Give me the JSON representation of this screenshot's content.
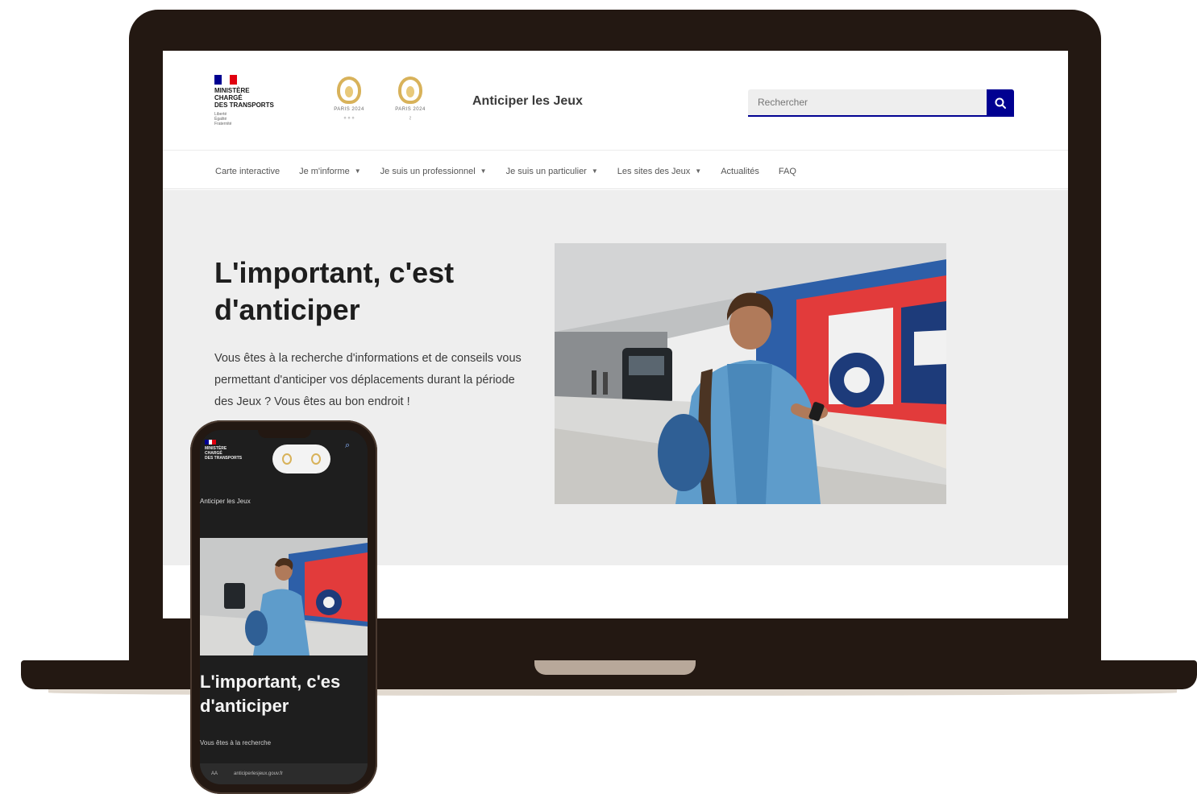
{
  "header": {
    "ministry_name": "Ministère\nchargé\ndes transports",
    "ministry_motto": "Liberté\nÉgalité\nFraternité",
    "games_logos": [
      {
        "caption": "PARIS 2024",
        "symbol": "∘∘∘"
      },
      {
        "caption": "PARIS 2024",
        "symbol": "≀"
      }
    ],
    "site_title": "Anticiper les Jeux",
    "search_placeholder": "Rechercher"
  },
  "nav": {
    "items": [
      {
        "label": "Carte interactive",
        "has_menu": false
      },
      {
        "label": "Je m'informe",
        "has_menu": true
      },
      {
        "label": "Je suis un professionnel",
        "has_menu": true
      },
      {
        "label": "Je suis un particulier",
        "has_menu": true
      },
      {
        "label": "Les sites des Jeux",
        "has_menu": true
      },
      {
        "label": "Actualités",
        "has_menu": false
      },
      {
        "label": "FAQ",
        "has_menu": false
      }
    ]
  },
  "hero": {
    "title": "L'important, c'est d'anticiper",
    "text": "Vous êtes à la recherche d'informations et de conseils vous permettant d'anticiper vos déplacements durant la période des Jeux ? Vous êtes au bon endroit !"
  },
  "phone": {
    "site_title": "Anticiper les Jeux",
    "hero_title": "L'important, c'es\nd'anticiper",
    "hero_text": "Vous êtes à la recherche",
    "url_text": "anticiperlesjeux.gouv.fr"
  },
  "colors": {
    "blue_france": "#000091",
    "red_marianne": "#e1000f",
    "device": "#231812",
    "gold": "#d8b25a"
  }
}
